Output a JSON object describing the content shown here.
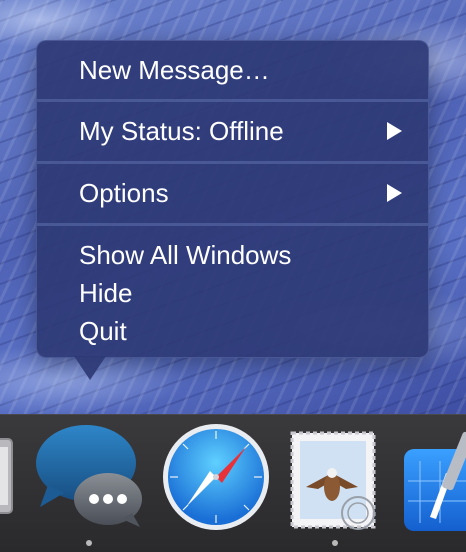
{
  "menu": {
    "items": [
      {
        "label": "New Message…",
        "submenu": false
      },
      {
        "label": "My Status: Offline",
        "submenu": true
      },
      {
        "label": "Options",
        "submenu": true
      },
      {
        "label": "Show All Windows",
        "submenu": false
      },
      {
        "label": "Hide",
        "submenu": false
      },
      {
        "label": "Quit",
        "submenu": false
      }
    ]
  },
  "dock": {
    "items": [
      {
        "icon": "partial-app-icon",
        "running": false
      },
      {
        "icon": "messages-icon",
        "running": true
      },
      {
        "icon": "safari-icon",
        "running": false
      },
      {
        "icon": "mail-icon",
        "running": true
      },
      {
        "icon": "xcode-icon",
        "running": false
      }
    ]
  },
  "colors": {
    "menu_bg": "#2e3a76",
    "menu_text": "#ffffff",
    "dock_bg": "#333335",
    "running_dot": "#b9b9b9"
  }
}
